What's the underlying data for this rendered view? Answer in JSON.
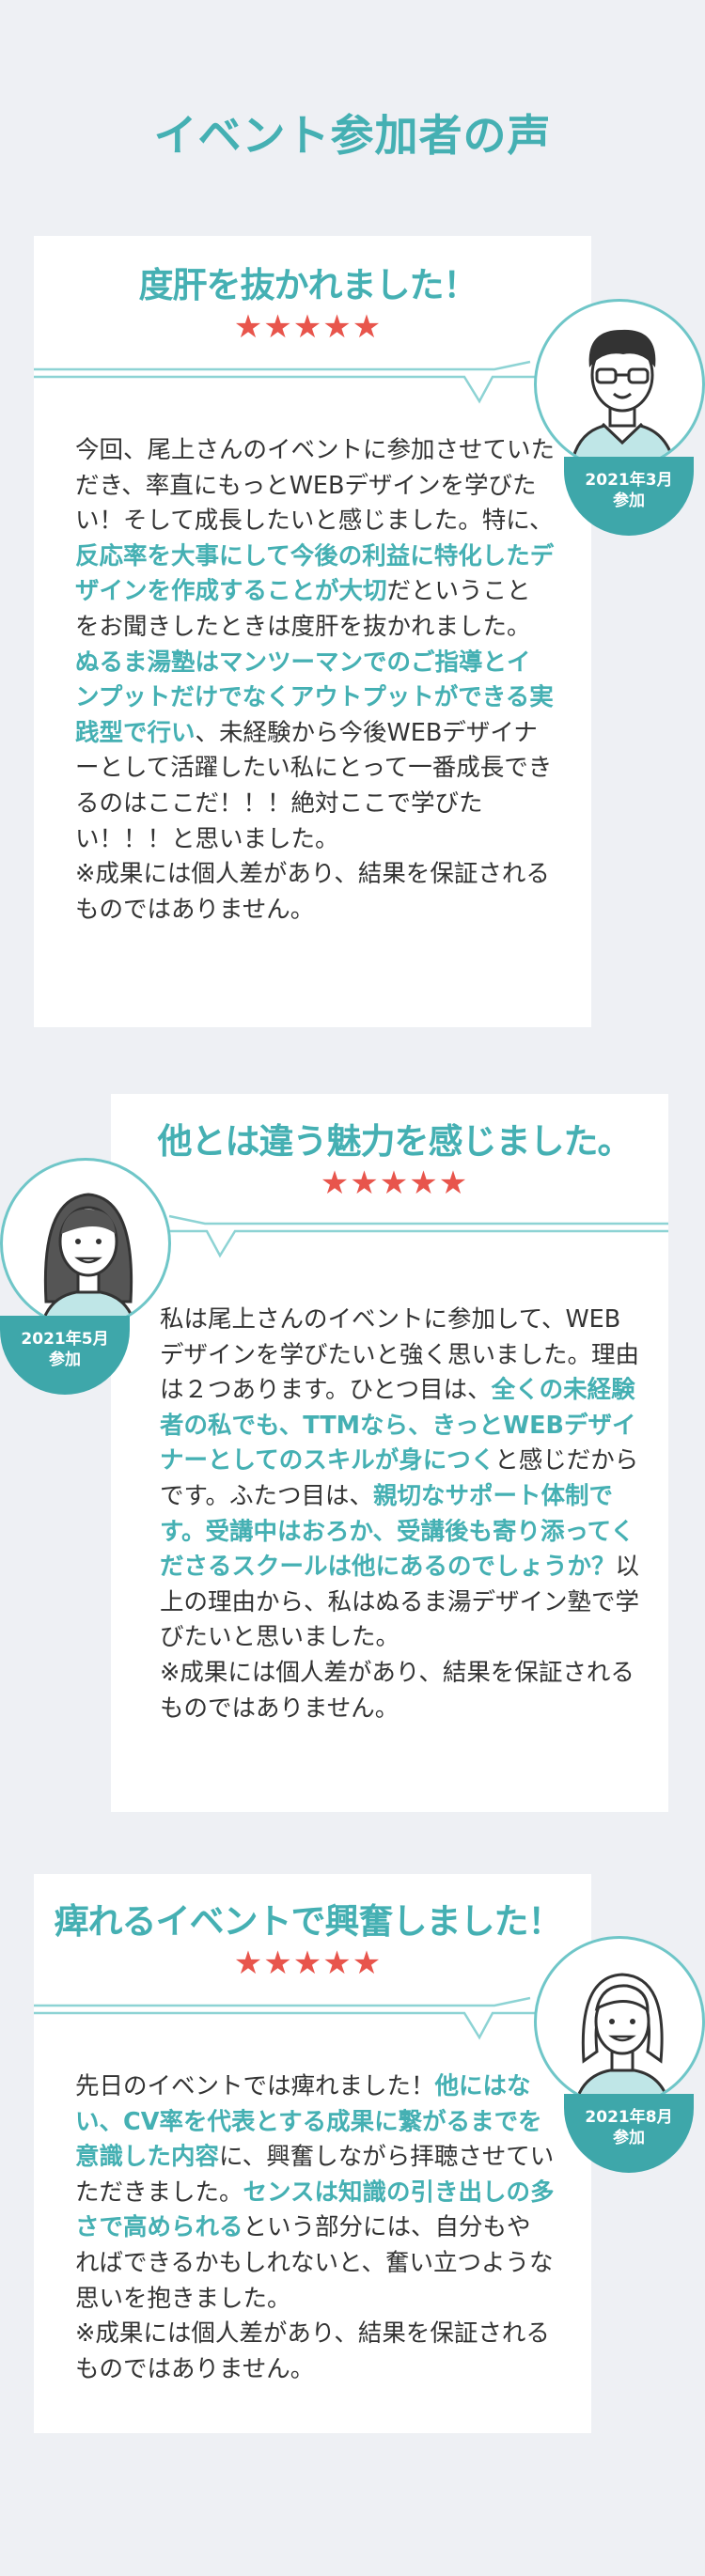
{
  "page": {
    "title": "イベント参加者の声"
  },
  "colors": {
    "accent": "#45b0b3",
    "star": "#e8554c",
    "badge": "#3ea7aa",
    "background": "#eef0f4"
  },
  "testimonials": [
    {
      "title": "度肝を抜かれました！",
      "stars": "★★★★★",
      "date": "2021年3月",
      "attend": "参加",
      "avatar_icon": "man-with-glasses-icon",
      "segments": [
        {
          "t": "今回、尾上さんのイベントに参加させていただき、率直にもっとWEBデザインを学びたい！そして成長したいと感じました。特に、",
          "hl": false
        },
        {
          "t": "反応率を大事にして今後の利益に特化したデザインを作成することが大切",
          "hl": true
        },
        {
          "t": "だということをお聞きしたときは度肝を抜かれました。",
          "hl": false
        },
        {
          "t": "ぬるま湯塾はマンツーマンでのご指導とインプットだけでなくアウトプットができる実践型で行い",
          "hl": true
        },
        {
          "t": "、未経験から今後WEBデザイナーとして活躍したい私にとって一番成長できるのはここだ！！！絶対ここで学びたい！！！と思いました。",
          "hl": false
        }
      ],
      "note": "※成果には個人差があり、結果を保証されるものではありません。"
    },
    {
      "title": "他とは違う魅力を感じました。",
      "stars": "★★★★★",
      "date": "2021年5月",
      "attend": "参加",
      "avatar_icon": "woman-long-hair-icon",
      "segments": [
        {
          "t": "私は尾上さんのイベントに参加して、WEBデザインを学びたいと強く思いました。理由は２つあります。ひとつ目は、",
          "hl": false
        },
        {
          "t": "全くの未経験者の私でも、TTMなら、きっとWEBデザイナーとしてのスキルが身につく",
          "hl": true
        },
        {
          "t": "と感じだからです。ふたつ目は、",
          "hl": false
        },
        {
          "t": "親切なサポート体制です。受講中はおろか、受講後も寄り添ってくださるスクールは他にあるのでしょうか？",
          "hl": true
        },
        {
          "t": "以上の理由から、私はぬるま湯デザイン塾で学びたいと思いました。",
          "hl": false
        }
      ],
      "note": "※成果には個人差があり、結果を保証されるものではありません。"
    },
    {
      "title": "痺れるイベントで興奮しました！",
      "stars": "★★★★★",
      "date": "2021年8月",
      "attend": "参加",
      "avatar_icon": "woman-short-hair-icon",
      "segments": [
        {
          "t": "先日のイベントでは痺れました！",
          "hl": false
        },
        {
          "t": "他にはない、CV率を代表とする成果に繋がるまでを意識した内容",
          "hl": true
        },
        {
          "t": "に、興奮しながら拝聴させていただきました。",
          "hl": false
        },
        {
          "t": "センスは知識の引き出しの多さで高められる",
          "hl": true
        },
        {
          "t": "という部分には、自分もやればできるかもしれないと、奮い立つような思いを抱きました。",
          "hl": false
        }
      ],
      "note": "※成果には個人差があり、結果を保証されるものではありません。"
    }
  ]
}
